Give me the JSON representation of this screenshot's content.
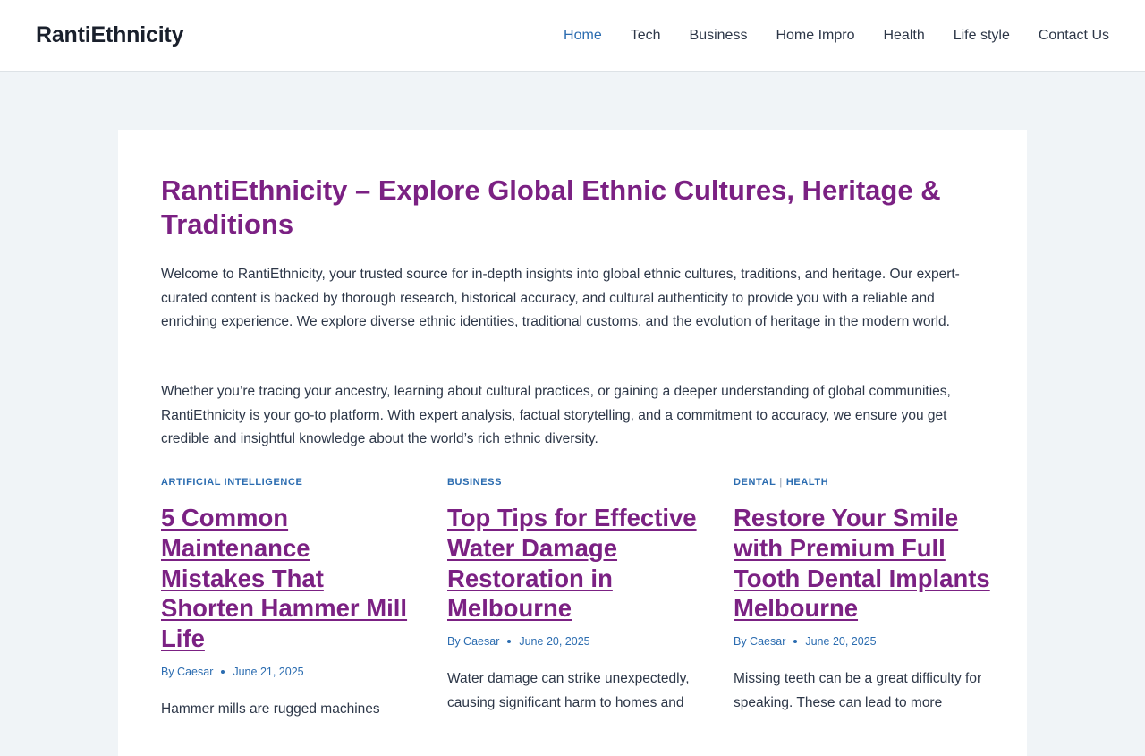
{
  "site": {
    "logo": "RantiEthnicity"
  },
  "nav": {
    "items": [
      {
        "label": "Home"
      },
      {
        "label": "Tech"
      },
      {
        "label": "Business"
      },
      {
        "label": "Home Impro"
      },
      {
        "label": "Health"
      },
      {
        "label": "Life style"
      },
      {
        "label": "Contact Us"
      }
    ]
  },
  "main": {
    "title": "RantiEthnicity – Explore Global Ethnic Cultures, Heritage & Traditions",
    "paragraphs": [
      "Welcome to RantiEthnicity, your trusted source for in-depth insights into global ethnic cultures, traditions, and heritage. Our expert-curated content is backed by thorough research, historical accuracy, and cultural authenticity to provide you with a reliable and enriching experience. We explore diverse ethnic identities, traditional customs, and the evolution of heritage in the modern world.",
      "Whether you’re tracing your ancestry, learning about cultural practices, or gaining a deeper understanding of global communities, RantiEthnicity is your go-to platform. With expert analysis, factual storytelling, and a commitment to accuracy, we ensure you get credible and insightful knowledge about the world’s rich ethnic diversity."
    ]
  },
  "posts": [
    {
      "categories": [
        "ARTIFICIAL INTELLIGENCE"
      ],
      "title": "5 Common Maintenance Mistakes That Shorten Hammer Mill Life",
      "author": "By Caesar",
      "date": "June 21, 2025",
      "excerpt": "Hammer mills are rugged machines"
    },
    {
      "categories": [
        "BUSINESS"
      ],
      "title": "Top Tips for Effective Water Damage Restoration in Melbourne",
      "author": "By Caesar",
      "date": "June 20, 2025",
      "excerpt": "Water damage can strike unexpectedly, causing significant harm to homes and"
    },
    {
      "categories": [
        "DENTAL",
        "HEALTH"
      ],
      "category_separator": "|",
      "title": "Restore Your Smile with Premium Full Tooth Dental Implants Melbourne",
      "author": "By Caesar",
      "date": "June 20, 2025",
      "excerpt": "Missing teeth can be a great difficulty for speaking. These can lead to more"
    }
  ],
  "colors": {
    "accent": "#7b2183",
    "link": "#2b6cb0",
    "background": "#f0f4f7"
  }
}
